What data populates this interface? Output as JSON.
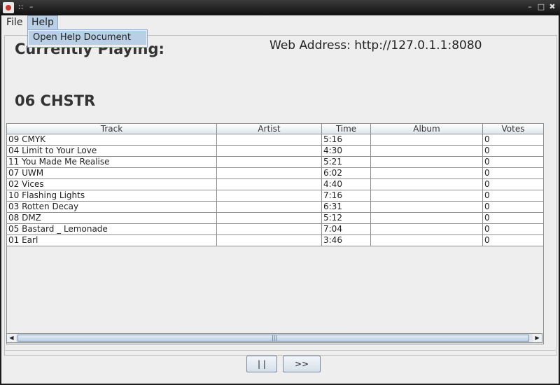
{
  "titlebar": {
    "glyph1": "::",
    "glyph2": "–",
    "min": "–",
    "max": "□",
    "close": "✖"
  },
  "menu": {
    "file": "File",
    "help": "Help",
    "help_items": [
      "Open Help Document"
    ]
  },
  "header": {
    "currently_playing": "Currently Playing:",
    "web_address": "Web Address: http://127.0.1.1:8080",
    "now_playing_track": "06 CHSTR"
  },
  "table": {
    "columns": [
      "Track",
      "Artist",
      "Time",
      "Album",
      "Votes"
    ],
    "rows": [
      {
        "track": "09 CMYK",
        "artist": "",
        "time": "5:16",
        "album": "",
        "votes": "0"
      },
      {
        "track": "04 Limit to Your Love",
        "artist": "",
        "time": "4:30",
        "album": "",
        "votes": "0"
      },
      {
        "track": "11 You Made Me Realise",
        "artist": "",
        "time": "5:21",
        "album": "",
        "votes": "0"
      },
      {
        "track": "07 UWM",
        "artist": "",
        "time": "6:02",
        "album": "",
        "votes": "0"
      },
      {
        "track": "02 Vices",
        "artist": "",
        "time": "4:40",
        "album": "",
        "votes": "0"
      },
      {
        "track": "10 Flashing Lights",
        "artist": "",
        "time": "7:16",
        "album": "",
        "votes": "0"
      },
      {
        "track": "03 Rotten Decay",
        "artist": "",
        "time": "6:31",
        "album": "",
        "votes": "0"
      },
      {
        "track": "08 DMZ",
        "artist": "",
        "time": "5:12",
        "album": "",
        "votes": "0"
      },
      {
        "track": "05 Bastard _ Lemonade",
        "artist": "",
        "time": "7:04",
        "album": "",
        "votes": "0"
      },
      {
        "track": "01 Earl",
        "artist": "",
        "time": "3:46",
        "album": "",
        "votes": "0"
      }
    ]
  },
  "scrollbar": {
    "left": "◀",
    "right": "▶",
    "grip": "|||"
  },
  "controls": {
    "pause": "| |",
    "next": ">>"
  }
}
